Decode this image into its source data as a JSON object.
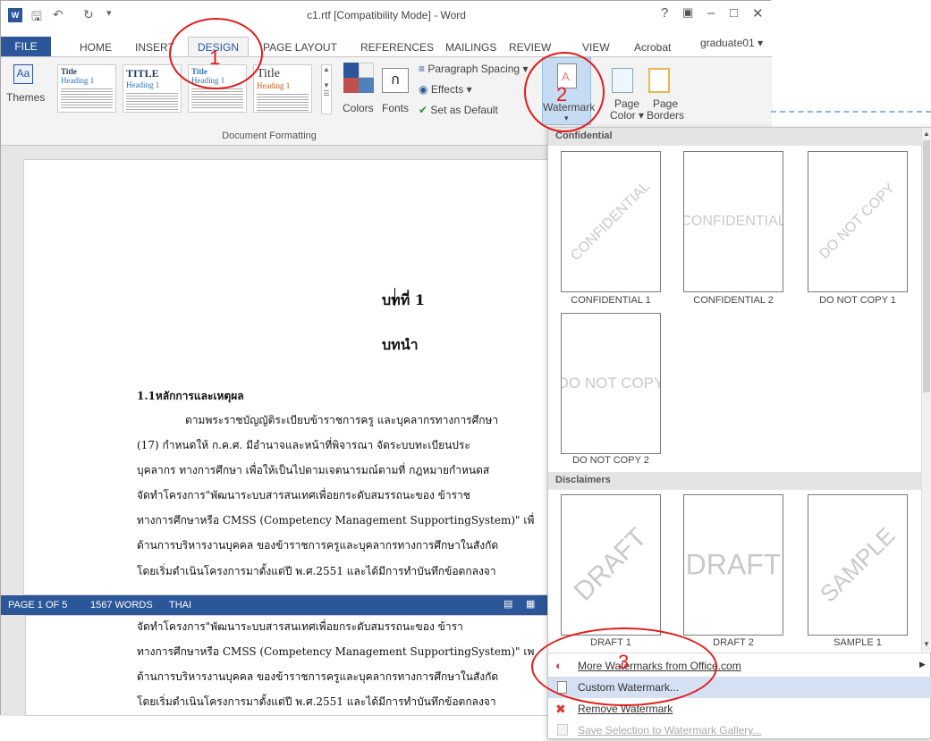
{
  "window": {
    "title": "c1.rtf [Compatibility Mode] - Word",
    "help": "?",
    "user": "graduate01"
  },
  "tabs": [
    "FILE",
    "HOME",
    "INSERT",
    "DESIGN",
    "PAGE LAYOUT",
    "REFERENCES",
    "MAILINGS",
    "REVIEW",
    "VIEW",
    "Acrobat"
  ],
  "ribbon": {
    "themes_label": "Themes",
    "style_thumbs": [
      {
        "title": "Title",
        "heading": "Heading 1"
      },
      {
        "title": "TITLE",
        "heading": "Heading 1"
      },
      {
        "title": "Title",
        "heading": "Heading 1"
      },
      {
        "title": "Title",
        "heading": "Heading 1"
      }
    ],
    "colors_label": "Colors",
    "fonts_label": "Fonts",
    "fonts_glyph": "ก",
    "paragraph_spacing": "Paragraph Spacing",
    "effects": "Effects",
    "set_default": "Set as Default",
    "group_label": "Document Formatting",
    "watermark_label": "Watermark",
    "page_color_label_1": "Page",
    "page_color_label_2": "Color",
    "page_borders_label_1": "Page",
    "page_borders_label_2": "Borders"
  },
  "document": {
    "chapter": "บทที่ 1",
    "heading": "บทนำ",
    "section": "1.1หลักการและเหตุผล",
    "lines": [
      "ตามพระราชบัญญัติระเบียบข้าราชการครู และบุคลากรทางการศึกษา",
      "(17) กำหนดให้ ก.ค.ศ. มีอำนาจและหน้าที่พิจารณา จัดระบบทะเบียนประ",
      "บุคลากร ทางการศึกษา เพื่อให้เป็นไปตามเจตนารมณ์ตามที่ กฎหมายกำหนดส",
      "จัดทำโครงการ\"พัฒนาระบบสารสนเทศเพื่อยกระดับสมรรถนะของ ข้าราช",
      "ทางการศึกษาหรือ CMSS (Competency Management SupportingSystem)\" เพื่",
      "ด้านการบริหารงานบุคคล ของข้าราชการครูและบุคลากรทางการศึกษาในสังกัด",
      "โดยเริ่มดำเนินโครงการมาตั้งแต่ปี พ.ศ.2551 และได้มีการทำบันทึกข้อตกลงจา"
    ],
    "lower_lines": [
      "จัดทำโครงการ\"พัฒนาระบบสารสนเทศเพื่อยกระดับสมรรถนะของ ข้ารา",
      "ทางการศึกษาหรือ CMSS (Competency Management SupportingSystem)\" เพ",
      "ด้านการบริหารงานบุคคล ของข้าราชการครูและบุคลากรทางการศึกษาในสังกัด",
      "โดยเริ่มดำเนินโครงการมาตั้งแต่ปี พ.ศ.2551 และได้มีการทำบันทึกข้อตกลงจา"
    ]
  },
  "status": {
    "page": "PAGE 1 OF 5",
    "words": "1567 WORDS",
    "lang": "THAI"
  },
  "gallery": {
    "sections": [
      "Confidential",
      "Disclaimers"
    ],
    "confidential": [
      {
        "text": "CONFIDENTIAL",
        "caption": "CONFIDENTIAL 1"
      },
      {
        "text": "CONFIDENTIAL",
        "caption": "CONFIDENTIAL 2"
      },
      {
        "text": "DO NOT COPY",
        "caption": "DO NOT COPY 1"
      },
      {
        "text": "DO NOT COPY",
        "caption": "DO NOT COPY 2"
      }
    ],
    "disclaimers": [
      {
        "text": "DRAFT",
        "caption": "DRAFT 1"
      },
      {
        "text": "DRAFT",
        "caption": "DRAFT 2"
      },
      {
        "text": "SAMPLE",
        "caption": "SAMPLE 1"
      }
    ],
    "menu": [
      "More Watermarks from Office.com",
      "Custom Watermark...",
      "Remove Watermark",
      "Save Selection to Watermark Gallery..."
    ]
  },
  "annotations": [
    "1",
    "2",
    "3"
  ],
  "colors": {
    "accent": "#2b579a",
    "annotation": "#e31b1b",
    "highlight": "#c5dcf2"
  }
}
